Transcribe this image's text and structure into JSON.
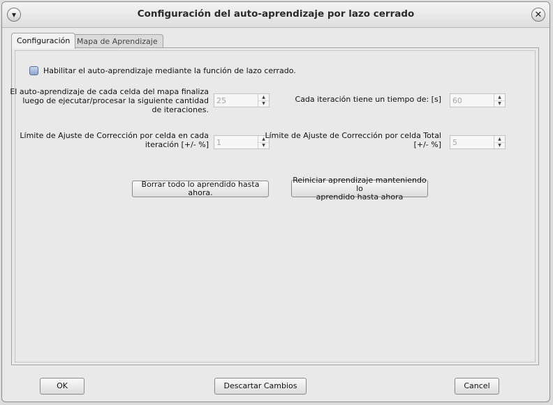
{
  "window": {
    "title": "Configuración del auto-aprendizaje por lazo cerrado"
  },
  "tabs": [
    {
      "label": "Configuración",
      "active": true
    },
    {
      "label": "Mapa de Aprendizaje",
      "active": false
    }
  ],
  "enable": {
    "label": "Habilitar el auto-aprendizaje mediante la función de lazo cerrado.",
    "checked": false
  },
  "fields": {
    "iterations": {
      "label_lines": [
        "El auto-aprendizaje de cada celda del mapa finaliza",
        "luego de ejecutar/procesar  la siguiente cantidad",
        "de iteraciones."
      ],
      "value": "25"
    },
    "iteration_time": {
      "label_lines": [
        "Cada iteración tiene un tiempo de: [s]"
      ],
      "value": "60"
    },
    "limit_per_iteration": {
      "label_lines": [
        "Límite de Ajuste de Corrección por celda en cada",
        "iteración  [+/- %]"
      ],
      "value": "1"
    },
    "limit_total": {
      "label_lines": [
        "Límite de Ajuste de Corrección por celda Total",
        "[+/- %]"
      ],
      "value": "5"
    }
  },
  "actions": {
    "clear_all": "Borrar todo lo aprendido hasta ahora.",
    "restart_keep": [
      "Reiniciar aprendizaje manteniendo lo",
      "aprendido hasta ahora"
    ]
  },
  "footer": {
    "ok": "OK",
    "discard": "Descartar Cambios",
    "cancel": "Cancel"
  },
  "icons": {
    "menu": "chevron-down-icon",
    "close": "close-icon",
    "spin_up": "triangle-up",
    "spin_down": "triangle-down"
  }
}
